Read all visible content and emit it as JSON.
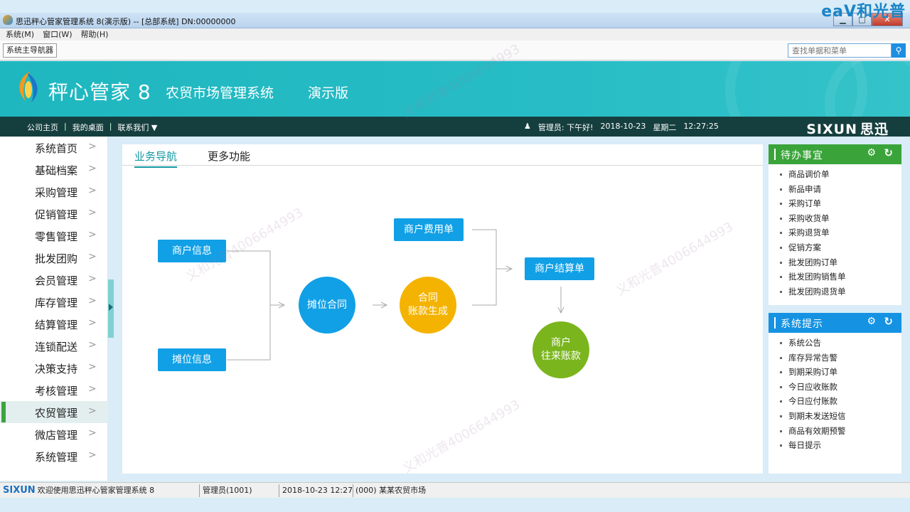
{
  "window": {
    "title": "思迅秤心管家管理系统 8(演示版) -- [总部系统] DN:00000000",
    "corner_brand": "eaV和光普",
    "minimize": "▁",
    "maximize": "□",
    "close": "✕"
  },
  "menu": [
    "系统(M)",
    "窗口(W)",
    "帮助(H)"
  ],
  "tabstrip": {
    "main_tab": "系统主导航器",
    "search_placeholder": "查找单据和菜单",
    "search_icon": "search-icon"
  },
  "banner": {
    "product": "秤心管家 8",
    "system_name": "农贸市场管理系统",
    "edition": "演示版"
  },
  "navbar": {
    "links": [
      "公司主页",
      "我的桌面",
      "联系我们 ▼"
    ],
    "separator": "|",
    "user": "管理员: 下午好!",
    "date": "2018-10-23",
    "weekday": "星期二",
    "time": "12:27:25",
    "logo": "SIXUN",
    "logo_cn": "思迅"
  },
  "sidebar": {
    "items": [
      {
        "label": "系统首页"
      },
      {
        "label": "基础档案"
      },
      {
        "label": "采购管理"
      },
      {
        "label": "促销管理"
      },
      {
        "label": "零售管理"
      },
      {
        "label": "批发团购"
      },
      {
        "label": "会员管理"
      },
      {
        "label": "库存管理"
      },
      {
        "label": "结算管理"
      },
      {
        "label": "连锁配送"
      },
      {
        "label": "决策支持"
      },
      {
        "label": "考核管理"
      },
      {
        "label": "农贸管理"
      },
      {
        "label": "微店管理"
      },
      {
        "label": "系统管理"
      }
    ],
    "active": "农贸管理",
    "chevron": ">"
  },
  "main": {
    "tabs": [
      "业务导航",
      "更多功能"
    ],
    "active_tab": "业务导航",
    "flow": {
      "merchant_info": "商户信息",
      "stall_info": "摊位信息",
      "stall_contract": "摊位合同",
      "contract_line1": "合同",
      "contract_line2": "账款生成",
      "merchant_fee": "商户费用单",
      "merchant_settle": "商户结算单",
      "merchant_ar_line1": "商户",
      "merchant_ar_line2": "往来账款"
    },
    "colors": {
      "box": "#11a0e6",
      "contract": "#11a0e6",
      "generate": "#f4b300",
      "account": "#7ab51d"
    }
  },
  "todo": {
    "title": "待办事宜",
    "items": [
      "商品调价单",
      "新品申请",
      "采购订单",
      "采购收货单",
      "采购退货单",
      "促销方案",
      "批发团购订单",
      "批发团购销售单",
      "批发团购退货单"
    ]
  },
  "tips": {
    "title": "系统提示",
    "items": [
      "系统公告",
      "库存异常告警",
      "到期采购订单",
      "今日应收账款",
      "今日应付账款",
      "到期未发送短信",
      "商品有效期预警",
      "每日提示"
    ]
  },
  "statusbar": {
    "logo": "SIXUN",
    "welcome": "欢迎使用思迅秤心管家管理系统 8",
    "user": "管理员(1001)",
    "datetime": "2018-10-23 12:27",
    "market": "(000) 某某农贸市场"
  },
  "watermark": "义和光普4006644993",
  "icons": {
    "gear": "gear-icon",
    "refresh": "refresh-icon"
  }
}
